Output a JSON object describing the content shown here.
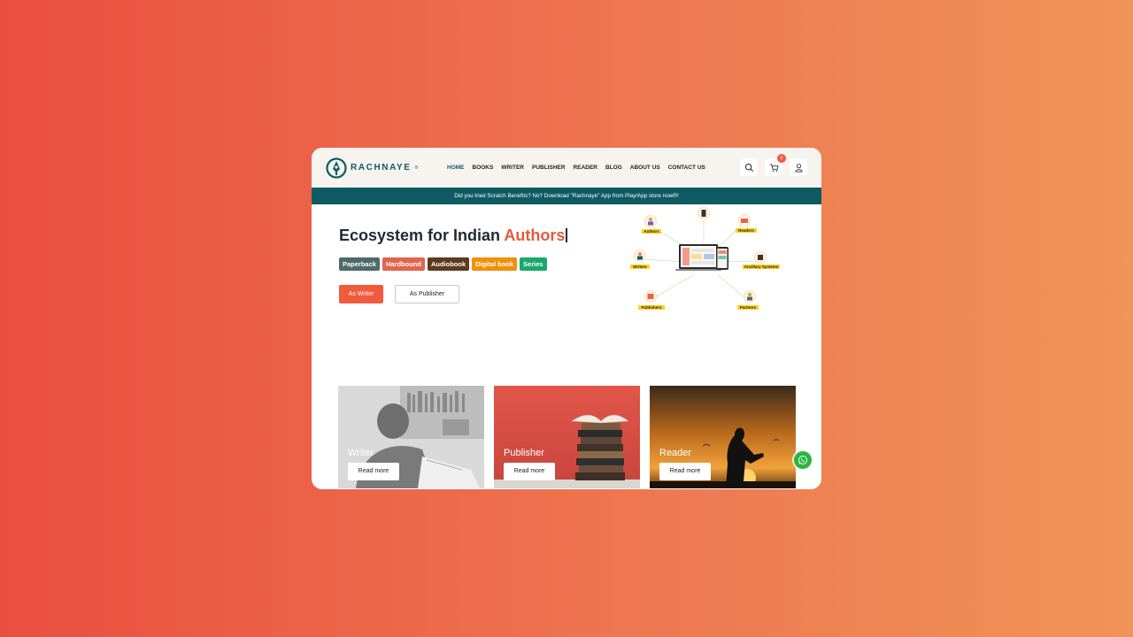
{
  "brand": {
    "name": "RACHNAYE",
    "registered": "®"
  },
  "nav": {
    "items": [
      {
        "label": "HOME",
        "active": true
      },
      {
        "label": "BOOKS",
        "active": false
      },
      {
        "label": "WRITER",
        "active": false
      },
      {
        "label": "PUBLISHER",
        "active": false
      },
      {
        "label": "READER",
        "active": false
      },
      {
        "label": "BLOG",
        "active": false
      },
      {
        "label": "ABOUT US",
        "active": false
      },
      {
        "label": "CONTACT US",
        "active": false
      }
    ],
    "icons": [
      "search-icon",
      "cart-icon",
      "user-icon"
    ],
    "cart_count": "0"
  },
  "announcement": "Did you tried Scratch Benefits? No? Download \"Rachnaye\" App from Play/App store now®!",
  "hero": {
    "title_prefix": "Ecosystem for Indian ",
    "title_accent": "Authors",
    "tags": [
      {
        "label": "Paperback",
        "color": "#4f6a6b"
      },
      {
        "label": "Hardbound",
        "color": "#e0664f"
      },
      {
        "label": "Audiobook",
        "color": "#5b3a1e"
      },
      {
        "label": "Digital book",
        "color": "#f0900c"
      },
      {
        "label": "Series",
        "color": "#1aa86a"
      }
    ],
    "buttons": {
      "writer": "As Writer",
      "publisher": "As Publisher"
    }
  },
  "ecosystem": {
    "nodes": [
      "Authors",
      "Readers",
      "Writers",
      "Ancillary Systems",
      "Publishers",
      "Partners"
    ]
  },
  "cards": [
    {
      "title": "Writer",
      "button": "Read more"
    },
    {
      "title": "Publisher",
      "button": "Read more"
    },
    {
      "title": "Reader",
      "button": "Read more"
    }
  ],
  "colors": {
    "brand": "#0f5b63",
    "accent": "#f05a3d"
  }
}
